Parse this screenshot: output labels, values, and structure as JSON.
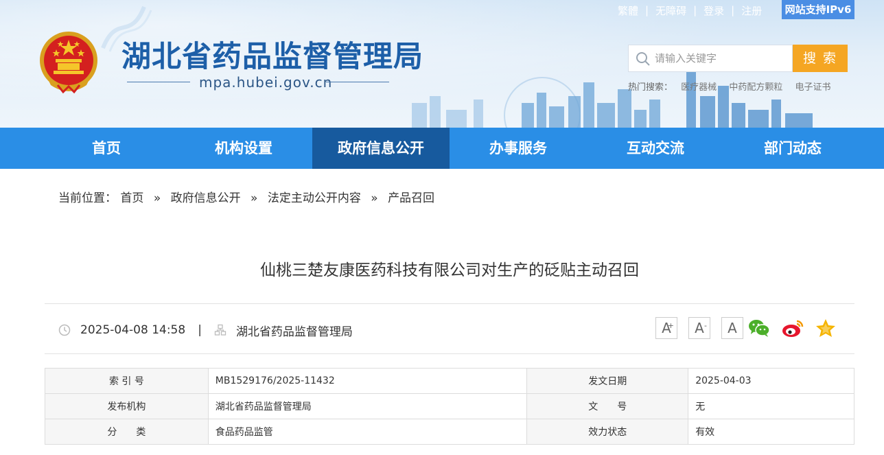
{
  "header": {
    "site_title": "湖北省药品监督管理局",
    "domain": "mpa.hubei.gov.cn",
    "top_links": [
      "繁體",
      "无障碍",
      "登录",
      "注册"
    ],
    "ipv6_badge": "网站支持IPv6",
    "search": {
      "placeholder": "请输入关键字",
      "button_label": "搜 索"
    },
    "hot_search": {
      "label": "热门搜索：",
      "items": [
        "医疗器械",
        "中药配方颗粒",
        "电子证书"
      ]
    }
  },
  "nav": {
    "items": [
      "首页",
      "机构设置",
      "政府信息公开",
      "办事服务",
      "互动交流",
      "部门动态"
    ],
    "active_index": 2
  },
  "breadcrumb": {
    "label": "当前位置：",
    "items": [
      "首页",
      "政府信息公开",
      "法定主动公开内容",
      "产品召回"
    ],
    "separator": "»"
  },
  "article": {
    "title": "仙桃三楚友康医药科技有限公司对生产的砭贴主动召回",
    "datetime": "2025-04-08 14:58",
    "divider": "|",
    "publisher": "湖北省药品监督管理局",
    "font_buttons": [
      "A",
      "A",
      "A"
    ],
    "font_button_sup": [
      "+",
      "-",
      ""
    ]
  },
  "info_table": [
    {
      "label_1": "索 引 号",
      "value_1": "MB1529176/2025-11432",
      "label_2": "发文日期",
      "value_2": "2025-04-03"
    },
    {
      "label_1": "发布机构",
      "value_1": "湖北省药品监督管理局",
      "label_2": "文　　号",
      "value_2": "无"
    },
    {
      "label_1": "分　　类",
      "value_1": "食品药品监管",
      "label_2": "效力状态",
      "value_2": "有效"
    }
  ],
  "icons": [
    "emblem-icon",
    "search-icon",
    "clock-icon",
    "org-icon",
    "wechat-icon",
    "weibo-icon",
    "favorite-star-icon"
  ],
  "colors": {
    "nav_bg": "#2a8ee6",
    "nav_active": "#175a9e",
    "search_btn": "#f5a623",
    "title_blue": "#1d5fa8",
    "ipv6_bg": "#4b8ee4"
  }
}
